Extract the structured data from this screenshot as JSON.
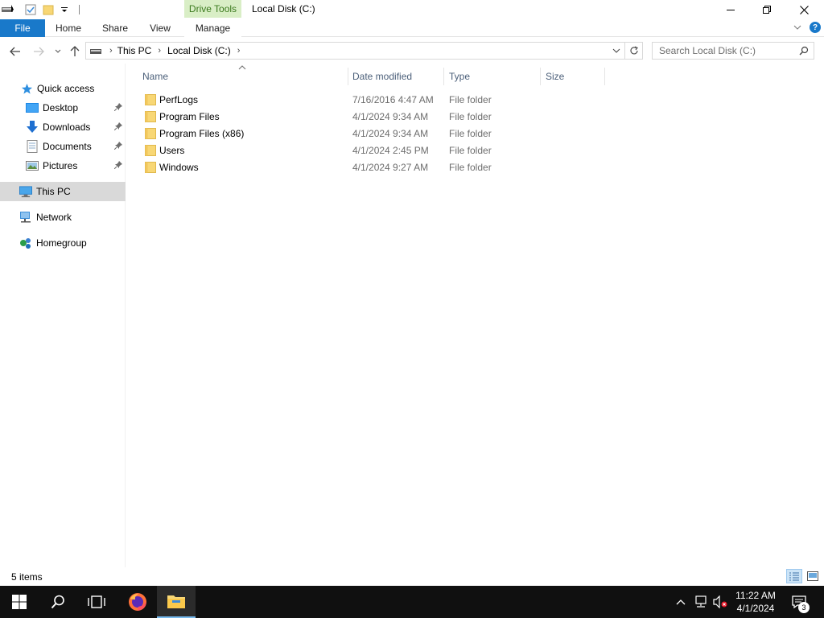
{
  "titlebar": {
    "context_tab": "Drive Tools",
    "window_title": "Local Disk (C:)"
  },
  "ribbon": {
    "tabs": [
      {
        "label": "File"
      },
      {
        "label": "Home"
      },
      {
        "label": "Share"
      },
      {
        "label": "View"
      },
      {
        "label": "Manage"
      }
    ]
  },
  "address": {
    "crumbs": [
      "This PC",
      "Local Disk (C:)"
    ]
  },
  "search": {
    "placeholder": "Search Local Disk (C:)"
  },
  "navpane": {
    "quick_access": "Quick access",
    "desktop": "Desktop",
    "downloads": "Downloads",
    "documents": "Documents",
    "pictures": "Pictures",
    "this_pc": "This PC",
    "network": "Network",
    "homegroup": "Homegroup"
  },
  "columns": {
    "name": "Name",
    "date": "Date modified",
    "type": "Type",
    "size": "Size"
  },
  "files": [
    {
      "name": "PerfLogs",
      "date": "7/16/2016 4:47 AM",
      "type": "File folder"
    },
    {
      "name": "Program Files",
      "date": "4/1/2024 9:34 AM",
      "type": "File folder"
    },
    {
      "name": "Program Files (x86)",
      "date": "4/1/2024 9:34 AM",
      "type": "File folder"
    },
    {
      "name": "Users",
      "date": "4/1/2024 2:45 PM",
      "type": "File folder"
    },
    {
      "name": "Windows",
      "date": "4/1/2024 9:27 AM",
      "type": "File folder"
    }
  ],
  "status": {
    "item_count": "5 items"
  },
  "taskbar": {
    "time": "11:22 AM",
    "date": "4/1/2024",
    "notification_count": "3"
  },
  "colors": {
    "file_tab": "#1979ca",
    "drive_tools_bg": "#d9eec6",
    "selected_nav": "#d9d9d9",
    "taskbar": "#101010",
    "folder_yellow": "#f8d775"
  }
}
